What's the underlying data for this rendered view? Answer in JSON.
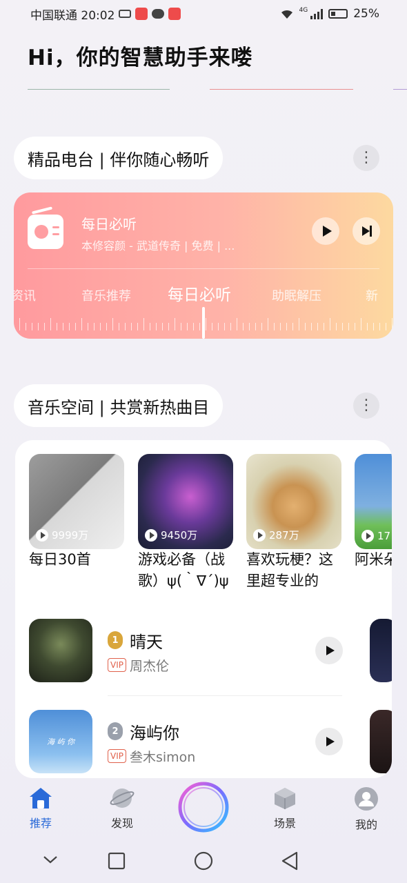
{
  "status_bar": {
    "carrier_time": "中国联通 20:02",
    "network": "4G",
    "battery": "25%"
  },
  "greeting": "Hi，你的智慧助手来喽",
  "radio_section": {
    "title": "精品电台 | 伴你随心畅听",
    "more": "⋮",
    "now_title": "每日必听",
    "now_sub": "本修容颜 - 武道传奇 | 免费 | ...",
    "tabs": [
      "资讯",
      "音乐推荐",
      "每日必听",
      "助眠解压",
      "新"
    ],
    "active_tab": 2
  },
  "music_section": {
    "title": "音乐空间 | 共赏新热曲目",
    "more": "⋮",
    "albums": [
      {
        "title": "每日30首",
        "plays": "9999万"
      },
      {
        "title": "游戏必备（战歌）ψ(｀∇´)ψ",
        "plays": "9450万"
      },
      {
        "title": "喜欢玩梗？这里超专业的",
        "plays": "287万"
      },
      {
        "title": "阿米朵喵",
        "plays": "17"
      }
    ],
    "songs": [
      {
        "rank": "1",
        "name": "晴天",
        "vip": "VIP",
        "artist": "周杰伦",
        "cover_text": ""
      },
      {
        "rank": "2",
        "name": "海屿你",
        "vip": "VIP",
        "artist": "叁木simon",
        "cover_text": "海 屿 你"
      }
    ]
  },
  "bottom_nav": [
    {
      "label": "推荐",
      "icon": "home-icon",
      "active": true
    },
    {
      "label": "发现",
      "icon": "planet-icon",
      "active": false
    },
    {
      "label": "",
      "icon": "assistant-orb-icon",
      "active": false
    },
    {
      "label": "场景",
      "icon": "cube-icon",
      "active": false
    },
    {
      "label": "我的",
      "icon": "profile-icon",
      "active": false
    }
  ],
  "colors": {
    "accent": "#2a6ad8",
    "radio_gradient_start": "#ff9a9e",
    "radio_gradient_end": "#fdd9a0",
    "vip": "#e0604a"
  }
}
